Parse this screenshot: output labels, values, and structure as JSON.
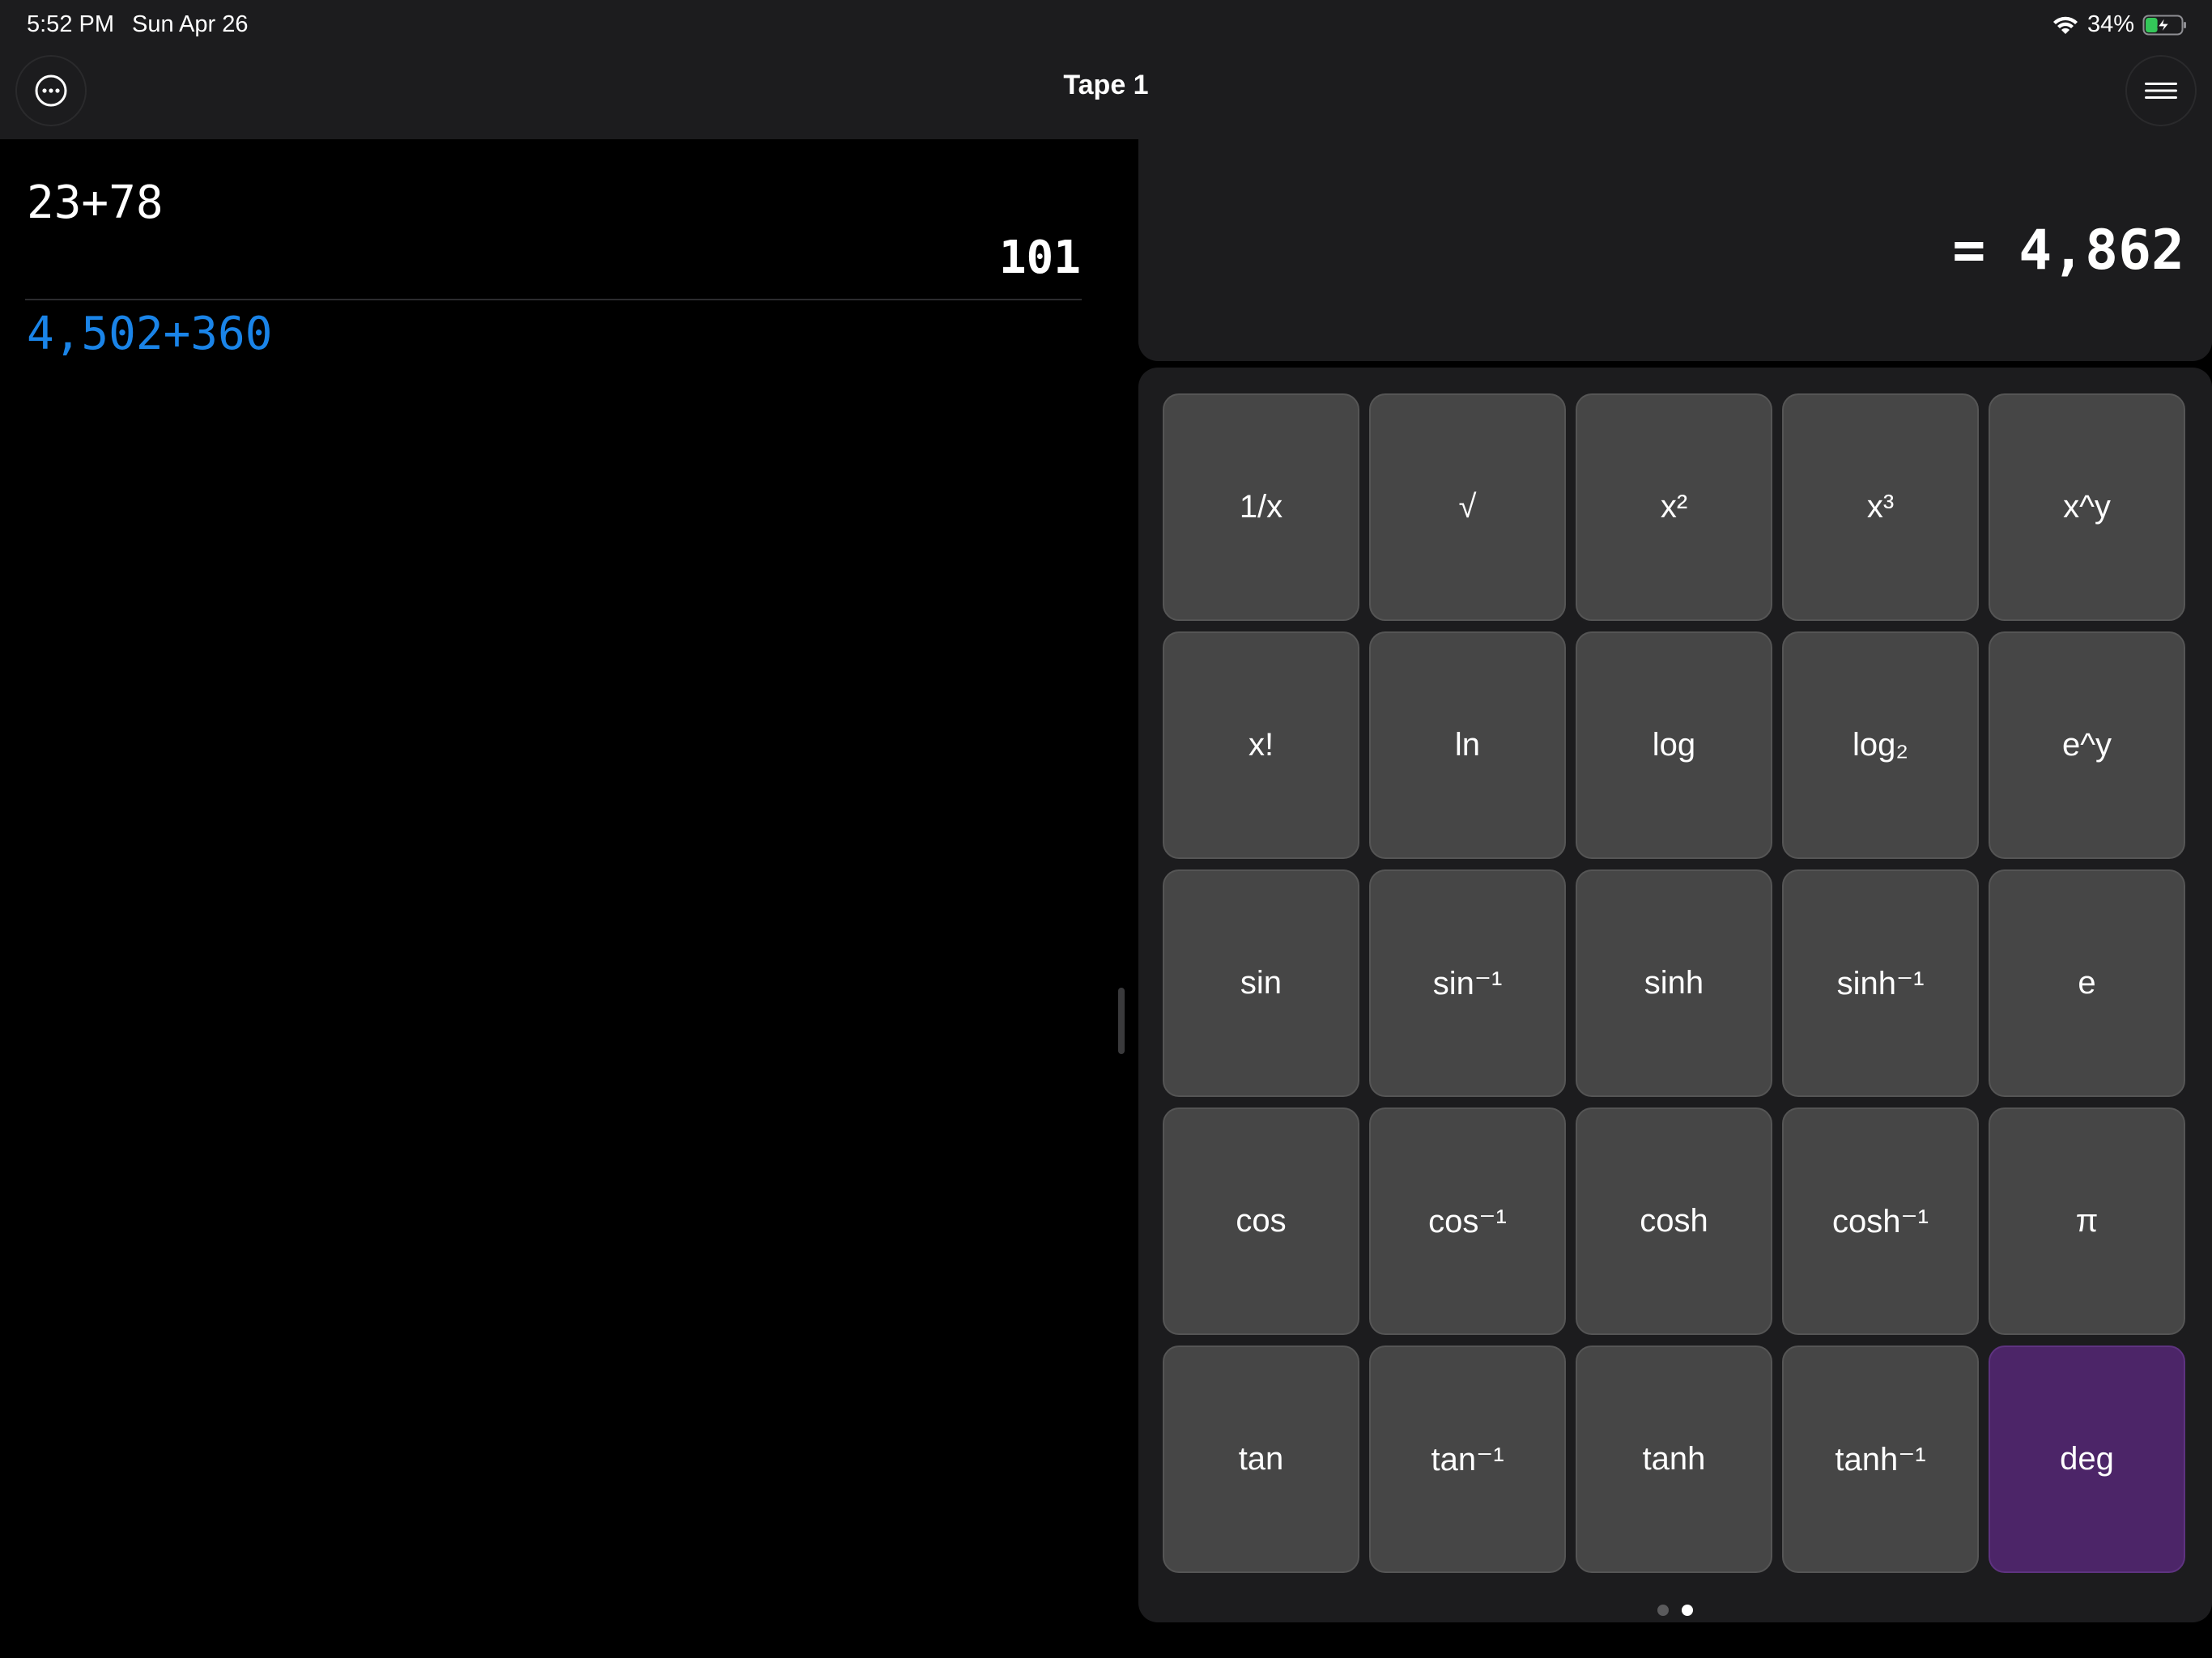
{
  "status": {
    "time": "5:52 PM",
    "date": "Sun Apr 26",
    "battery": "34%",
    "battery_level": 0.34
  },
  "nav": {
    "title": "Tape 1"
  },
  "tape": {
    "entries": [
      {
        "expression": "23+78",
        "result": "101"
      }
    ],
    "current": "4,502+360"
  },
  "display": {
    "value": "= 4,862"
  },
  "keypad": {
    "keys": [
      "1/x",
      "√",
      "x²",
      "x³",
      "x^y",
      "x!",
      "ln",
      "log",
      "log₂",
      "e^y",
      "sin",
      "sin⁻¹",
      "sinh",
      "sinh⁻¹",
      "e",
      "cos",
      "cos⁻¹",
      "cosh",
      "cosh⁻¹",
      "π",
      "tan",
      "tan⁻¹",
      "tanh",
      "tanh⁻¹",
      "deg"
    ],
    "page_count": 2,
    "active_page": 2
  },
  "colors": {
    "accent_key": "#4c2568",
    "expression_blue": "#1a84e8",
    "key": "#464646"
  }
}
